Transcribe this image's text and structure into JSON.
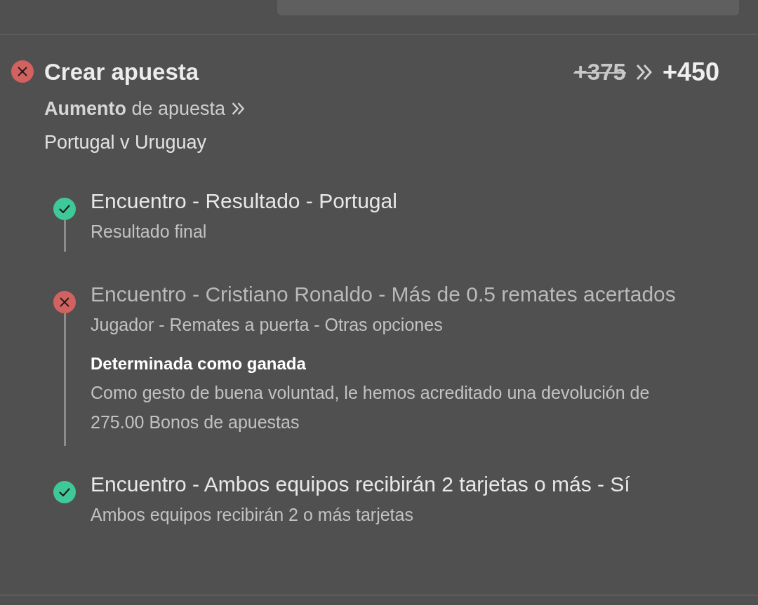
{
  "header": {
    "won": false,
    "title": "Crear apuesta",
    "old_odds": "+375",
    "new_odds": "+450",
    "boost_label": "**Aumento** de apuesta",
    "match": "Portugal v Uruguay"
  },
  "legs": [
    {
      "won": true,
      "title": "Encuentro - Resultado - Portugal",
      "subtitle": "Resultado final"
    },
    {
      "won": false,
      "title": "Encuentro - Cristiano Ronaldo - Más de 0.5 remates acertados",
      "subtitle": "Jugador - Remates a puerta - Otras opciones",
      "note": {
        "title": "Determinada como ganada",
        "text": "Como gesto de buena voluntad, le hemos acreditado una devolución de 275.00 Bonos de apuestas"
      }
    },
    {
      "won": true,
      "title": "Encuentro - Ambos equipos recibirán 2 tarjetas o más - Sí",
      "subtitle": "Ambos equipos recibirán 2 o más tarjetas"
    }
  ]
}
